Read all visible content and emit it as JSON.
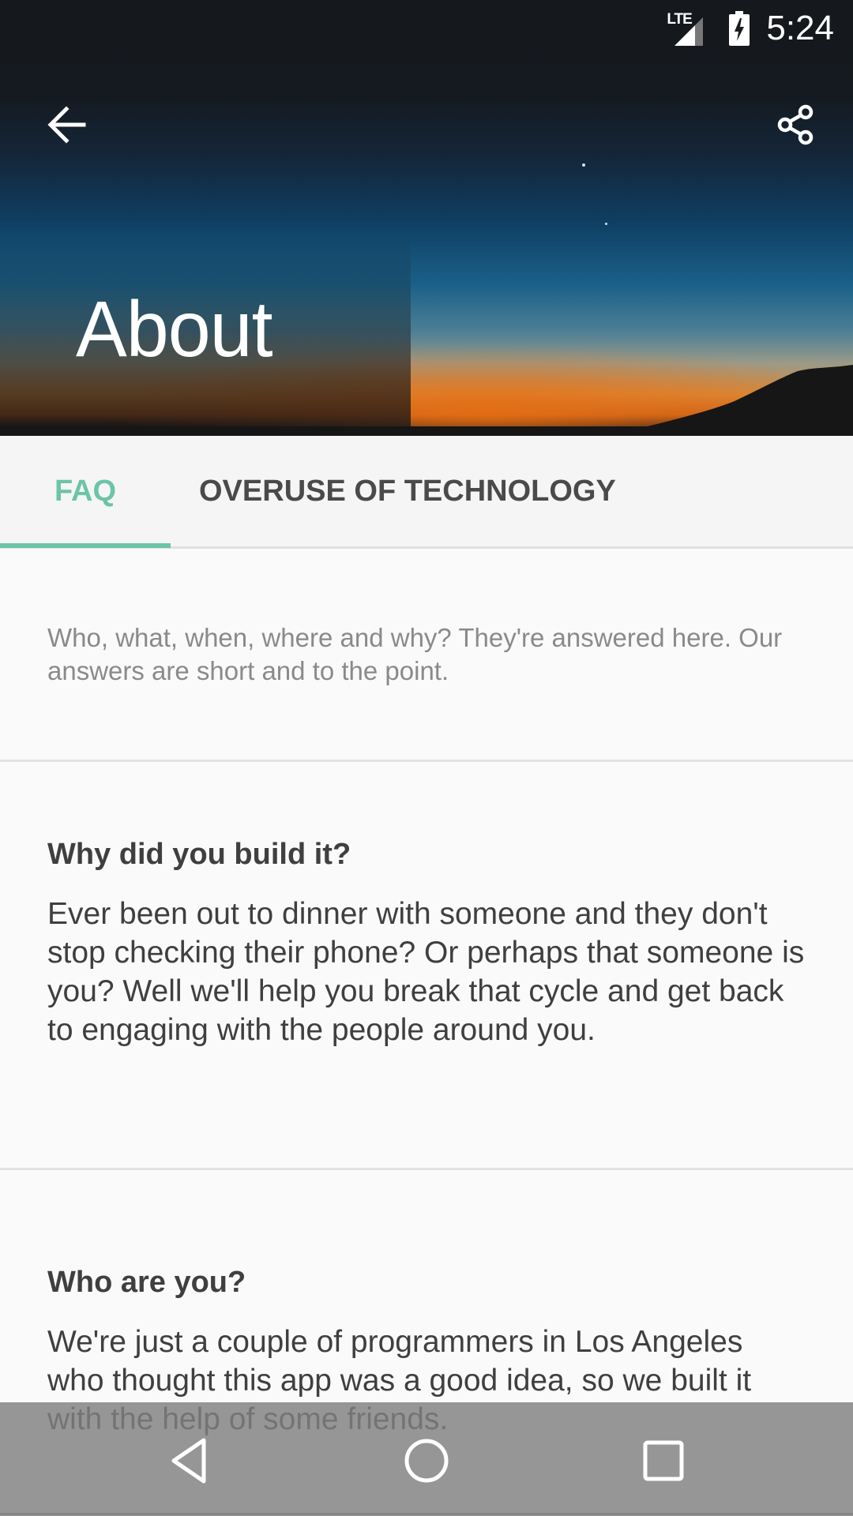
{
  "status_bar": {
    "network_label": "LTE",
    "time": "5:24",
    "icons": [
      "lte-signal-icon",
      "battery-charging-icon"
    ]
  },
  "toolbar": {
    "back_icon": "arrow-back-icon",
    "share_icon": "share-icon",
    "title": "About"
  },
  "tabs": {
    "items": [
      {
        "label": "FAQ",
        "selected": true
      },
      {
        "label": "OVERUSE OF TECHNOLOGY",
        "selected": false
      }
    ],
    "accent_color": "#6cc4a8"
  },
  "faq": {
    "intro": "Who, what, when, where and why? They're answered here. Our answers are short and to the point.",
    "items": [
      {
        "question": "Why did you build it?",
        "answer": "Ever been out to dinner with someone and they don't stop checking their phone?  Or perhaps that someone is you?  Well we'll help you break that cycle and get back to engaging with the people around you."
      },
      {
        "question": "Who are you?",
        "answer": "We're just a couple of programmers in Los Angeles who thought this app was a good idea, so we built it with the help of some friends."
      }
    ]
  },
  "nav_bar": {
    "icons": [
      "nav-back-icon",
      "nav-home-icon",
      "nav-recents-icon"
    ]
  }
}
